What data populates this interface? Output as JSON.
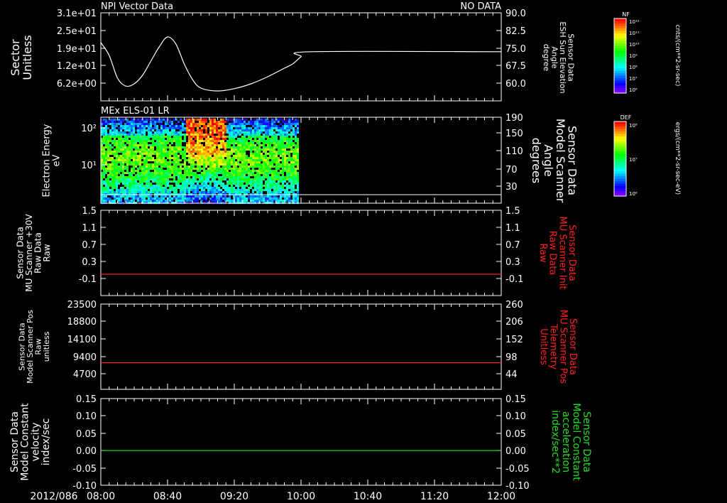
{
  "time_axis": {
    "date_label": "2012/086",
    "tick_labels": [
      "08:00",
      "08:40",
      "09:20",
      "10:00",
      "10:40",
      "11:20",
      "12:00"
    ],
    "range_minutes": [
      0,
      240
    ]
  },
  "colors": {
    "background": "#000000",
    "axis": "#ffffff",
    "red_trace": "#ff2020",
    "green_trace": "#22dd22"
  },
  "chart_data": [
    {
      "type": "line",
      "title": "NPI Vector Data",
      "status_text": "NO DATA",
      "ylabel": [
        "Sector",
        "Unitless"
      ],
      "yticks": [
        "3.1e+01",
        "2.5e+01",
        "1.9e+01",
        "1.2e+01",
        "6.2e+00"
      ],
      "ylim": [
        0,
        31
      ],
      "right_ylabel": [
        "Sensor Data",
        "ESH Sun Elevation",
        "Angle",
        "degree"
      ],
      "right_yticks": [
        "90.0",
        "82.5",
        "75.0",
        "67.5",
        "60.0"
      ],
      "right_ylim": [
        52.5,
        90
      ],
      "series": [
        {
          "x": [
            0,
            5,
            10,
            15,
            20,
            25,
            30,
            35,
            40,
            45,
            50,
            55,
            60,
            70,
            80,
            90,
            100,
            110,
            115,
            120,
            126,
            240
          ],
          "y": [
            20.5,
            16,
            8,
            5.2,
            6,
            9,
            14,
            19,
            22.5,
            20,
            13,
            7.5,
            4.5,
            3.5,
            4.3,
            6,
            8.5,
            11.5,
            13,
            15.5,
            17.3,
            17.3
          ]
        }
      ]
    },
    {
      "type": "heatmap",
      "title": "MEx ELS-01 LR",
      "ylabel": [
        "Electron Energy",
        "eV"
      ],
      "yticks": [
        "10²",
        "10¹"
      ],
      "right_ylabel": [
        "Sensor Data",
        "Model Scanner",
        "Angle",
        "degrees"
      ],
      "right_yticks": [
        "190",
        "150",
        "110",
        "70",
        "30"
      ],
      "data_range_minutes": [
        0,
        118
      ],
      "high_flux_interval_minutes": [
        50,
        75
      ]
    },
    {
      "type": "line",
      "ylabel": [
        "Sensor Data",
        "MU Scanner +30V",
        "Raw Data",
        "Raw"
      ],
      "yticks": [
        "1.5",
        "1.1",
        "0.7",
        "0.3",
        "-0.1"
      ],
      "ylim": [
        -0.5,
        1.5
      ],
      "right_ylabel": [
        "Sensor Data",
        "MU Scanner Init",
        "Raw Data",
        "Raw"
      ],
      "right_yticks": [
        "1.5",
        "1.1",
        "0.7",
        "0.3",
        "-0.1"
      ],
      "series": [
        {
          "color": "#ff2020",
          "x": [
            0,
            240
          ],
          "y": [
            0.0,
            0.0
          ]
        }
      ]
    },
    {
      "type": "line",
      "ylabel": [
        "Sensor Data",
        "Model Scanner Pos",
        "Raw",
        "unitless"
      ],
      "yticks": [
        "23500",
        "18800",
        "14100",
        "9400",
        "4700"
      ],
      "ylim": [
        0,
        23500
      ],
      "right_ylabel": [
        "Sensor Data",
        "MU Scanner Pos",
        "Telemetry",
        "Unitless"
      ],
      "right_yticks": [
        "260",
        "206",
        "152",
        "98",
        "44"
      ],
      "series": [
        {
          "color": "#ff2020",
          "x": [
            0,
            240
          ],
          "y": [
            7350,
            7350
          ]
        }
      ]
    },
    {
      "type": "line",
      "ylabel": [
        "Sensor Data",
        "Model Constant",
        "velocity",
        "index/sec"
      ],
      "yticks": [
        "0.15",
        "0.10",
        "0.05",
        "0.00",
        "-0.05",
        "-0.10"
      ],
      "ylim": [
        -0.1,
        0.15
      ],
      "right_ylabel": [
        "Sensor Data",
        "Model Constant",
        "acceleration",
        "index/sec**2"
      ],
      "right_yticks": [
        "0.15",
        "0.10",
        "0.05",
        "0.00",
        "-0.05",
        "-0.10"
      ],
      "series": [
        {
          "color": "#22dd22",
          "x": [
            0,
            240
          ],
          "y": [
            0.0,
            0.0
          ]
        }
      ]
    }
  ],
  "colorbars": [
    {
      "tag": "NF",
      "tick_labels": [
        "10¹²",
        "10¹¹",
        "10¹⁰",
        "10⁹",
        "10⁸",
        "10⁷",
        "10⁶"
      ],
      "unit_label": "cnts/(cm**2-sr-sec)"
    },
    {
      "tag": "DEF",
      "tick_labels": [
        "10⁸",
        "10⁷",
        "10⁶"
      ],
      "unit_label": "ergs/(cm**2-sr-sec-eV)"
    }
  ]
}
